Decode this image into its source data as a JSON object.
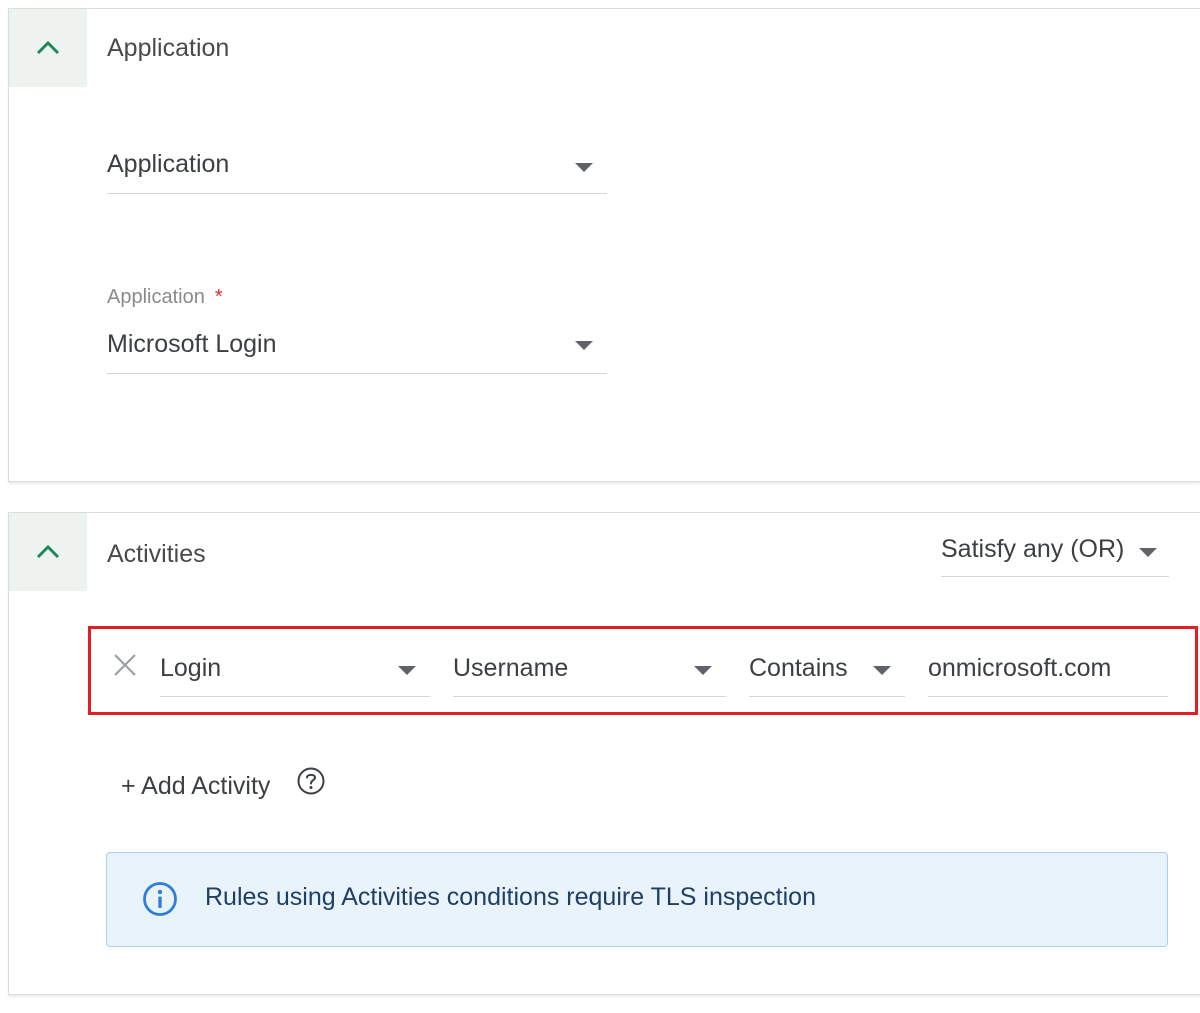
{
  "application_section": {
    "title": "Application",
    "type_select": {
      "value": "Application"
    },
    "app_select": {
      "label": "Application",
      "required_mark": "*",
      "value": "Microsoft Login"
    }
  },
  "activities_section": {
    "title": "Activities",
    "match_mode": "Satisfy any (OR)",
    "rule": {
      "activity": "Login",
      "attribute": "Username",
      "operator": "Contains",
      "value": "onmicrosoft.com"
    },
    "add_activity_label": "+ Add Activity",
    "info_banner": "Rules using Activities conditions require TLS inspection"
  },
  "colors": {
    "accent_green": "#1e8a5a",
    "highlight_red": "#e31e24",
    "info_blue": "#2f7fd8",
    "info_bg": "#e8f3fc"
  },
  "icons": {
    "collapse": "chevron-up-icon",
    "dropdown": "caret-down-icon",
    "remove": "close-icon",
    "help": "help-circle-icon",
    "info": "info-circle-icon"
  }
}
